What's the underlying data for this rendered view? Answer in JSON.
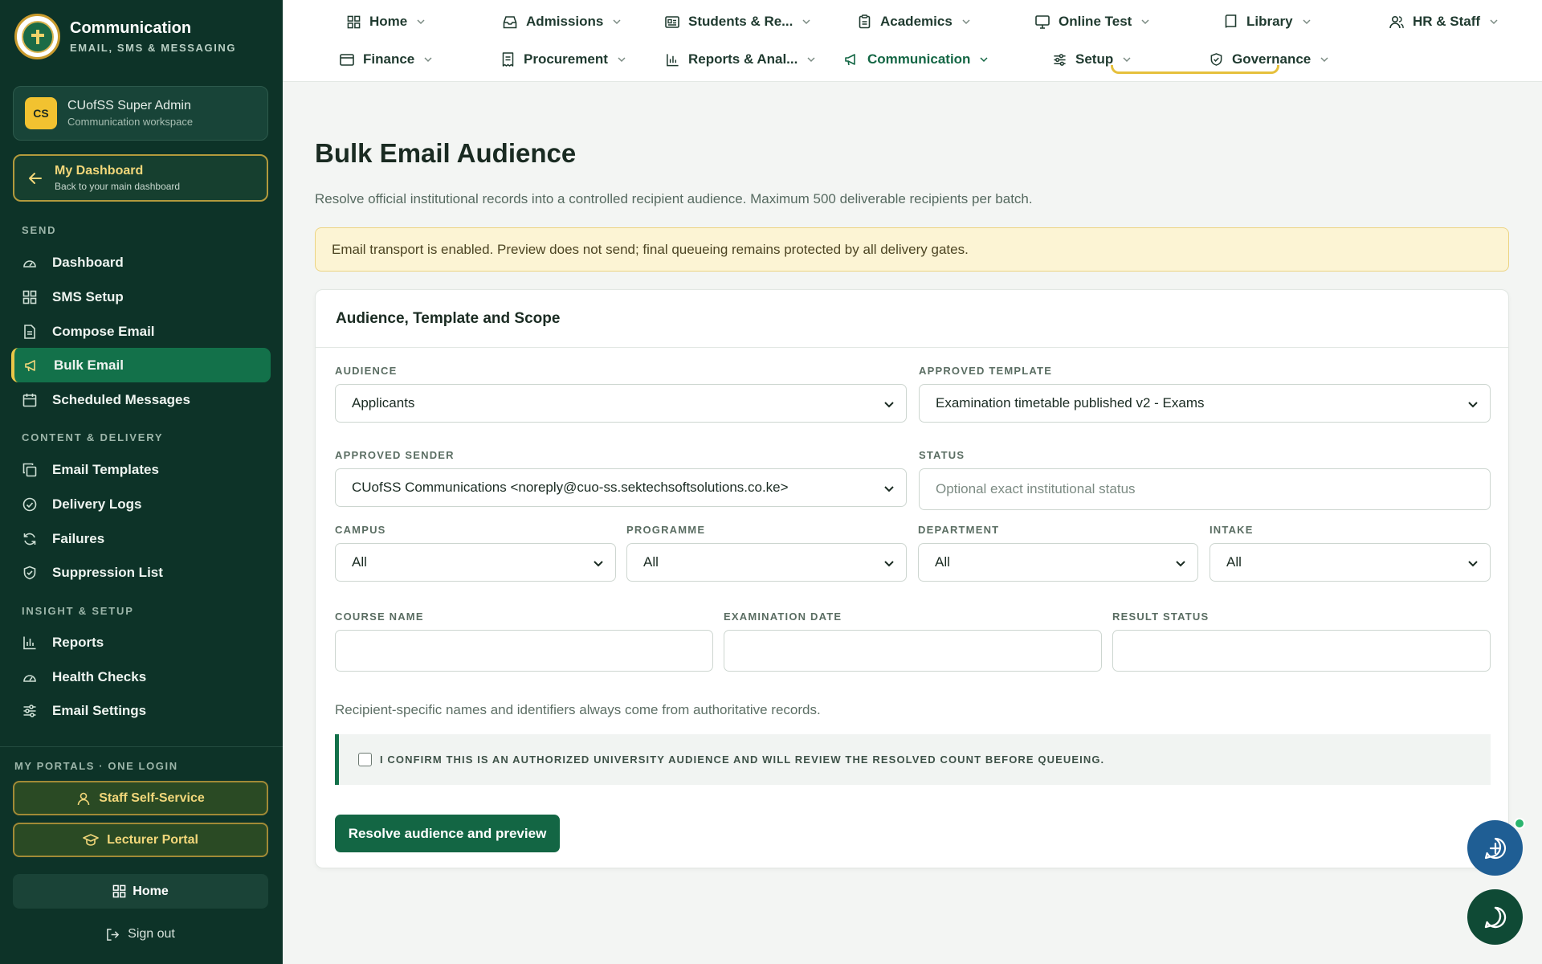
{
  "brand": {
    "title": "Communication",
    "subtitle": "EMAIL, SMS & MESSAGING"
  },
  "user": {
    "initials": "CS",
    "name": "CUofSS Super Admin",
    "role": "Communication workspace"
  },
  "dashboard_link": {
    "title": "My Dashboard",
    "subtitle": "Back to your main dashboard"
  },
  "sidebar": {
    "sections": [
      {
        "label": "SEND",
        "items": [
          {
            "label": "Dashboard",
            "icon": "gauge-icon"
          },
          {
            "label": "SMS Setup",
            "icon": "grid-icon"
          },
          {
            "label": "Compose Email",
            "icon": "document-icon"
          },
          {
            "label": "Bulk Email",
            "icon": "megaphone-icon",
            "active": true
          },
          {
            "label": "Scheduled Messages",
            "icon": "calendar-icon"
          }
        ]
      },
      {
        "label": "CONTENT & DELIVERY",
        "items": [
          {
            "label": "Email Templates",
            "icon": "copy-icon"
          },
          {
            "label": "Delivery Logs",
            "icon": "check-circle-icon"
          },
          {
            "label": "Failures",
            "icon": "refresh-icon"
          },
          {
            "label": "Suppression List",
            "icon": "shield-check-icon"
          }
        ]
      },
      {
        "label": "INSIGHT & SETUP",
        "items": [
          {
            "label": "Reports",
            "icon": "bar-chart-icon"
          },
          {
            "label": "Health Checks",
            "icon": "gauge-icon"
          },
          {
            "label": "Email Settings",
            "icon": "sliders-icon"
          }
        ]
      }
    ],
    "portals_label": "MY PORTALS · ONE LOGIN",
    "portals": [
      {
        "label": "Staff Self-Service",
        "icon": "user-icon"
      },
      {
        "label": "Lecturer Portal",
        "icon": "graduation-cap-icon"
      }
    ],
    "home_label": "Home",
    "signout_label": "Sign out"
  },
  "topnav": {
    "row1": [
      {
        "label": "Home",
        "icon": "grid-icon"
      },
      {
        "label": "Admissions",
        "icon": "inbox-icon"
      },
      {
        "label": "Students & Re...",
        "icon": "id-card-icon"
      },
      {
        "label": "Academics",
        "icon": "clipboard-icon"
      },
      {
        "label": "Online Test",
        "icon": "monitor-icon"
      },
      {
        "label": "Library",
        "icon": "book-icon"
      },
      {
        "label": "HR & Staff",
        "icon": "users-icon"
      }
    ],
    "row2": [
      {
        "label": "Finance",
        "icon": "wallet-icon"
      },
      {
        "label": "Procurement",
        "icon": "receipt-icon"
      },
      {
        "label": "Reports & Anal...",
        "icon": "bar-chart-icon"
      },
      {
        "label": "Communication",
        "icon": "megaphone-icon",
        "active": true
      },
      {
        "label": "Setup",
        "icon": "sliders-icon"
      },
      {
        "label": "Governance",
        "icon": "shield-check-icon"
      }
    ]
  },
  "page": {
    "title": "Bulk Email Audience",
    "description": "Resolve official institutional records into a controlled recipient audience. Maximum 500 deliverable recipients per batch.",
    "banner": "Email transport is enabled. Preview does not send; final queueing remains protected by all delivery gates."
  },
  "form": {
    "card_title": "Audience, Template and Scope",
    "audience": {
      "label": "AUDIENCE",
      "value": "Applicants"
    },
    "template": {
      "label": "APPROVED TEMPLATE",
      "value": "Examination timetable published v2 - Exams"
    },
    "sender": {
      "label": "APPROVED SENDER",
      "value": "CUofSS Communications <noreply@cuo-ss.sektechsoftsolutions.co.ke>"
    },
    "status": {
      "label": "STATUS",
      "placeholder": "Optional exact institutional status"
    },
    "campus": {
      "label": "CAMPUS",
      "value": "All"
    },
    "programme": {
      "label": "PROGRAMME",
      "value": "All"
    },
    "department": {
      "label": "DEPARTMENT",
      "value": "All"
    },
    "intake": {
      "label": "INTAKE",
      "value": "All"
    },
    "course_name": {
      "label": "COURSE NAME",
      "value": ""
    },
    "exam_date": {
      "label": "EXAMINATION DATE",
      "value": ""
    },
    "result_status": {
      "label": "RESULT STATUS",
      "value": ""
    },
    "note": "Recipient-specific names and identifiers always come from authoritative records.",
    "confirm_text": "I CONFIRM THIS IS AN AUTHORIZED UNIVERSITY AUDIENCE AND WILL REVIEW THE RESOLVED COUNT BEFORE QUEUEING.",
    "confirm_checked": false,
    "submit_label": "Resolve audience and preview"
  },
  "colors": {
    "sidebar_bg": "#0d3328",
    "accent_green": "#136644",
    "accent_gold": "#e6c03c",
    "banner_bg": "#fcf4d4"
  }
}
